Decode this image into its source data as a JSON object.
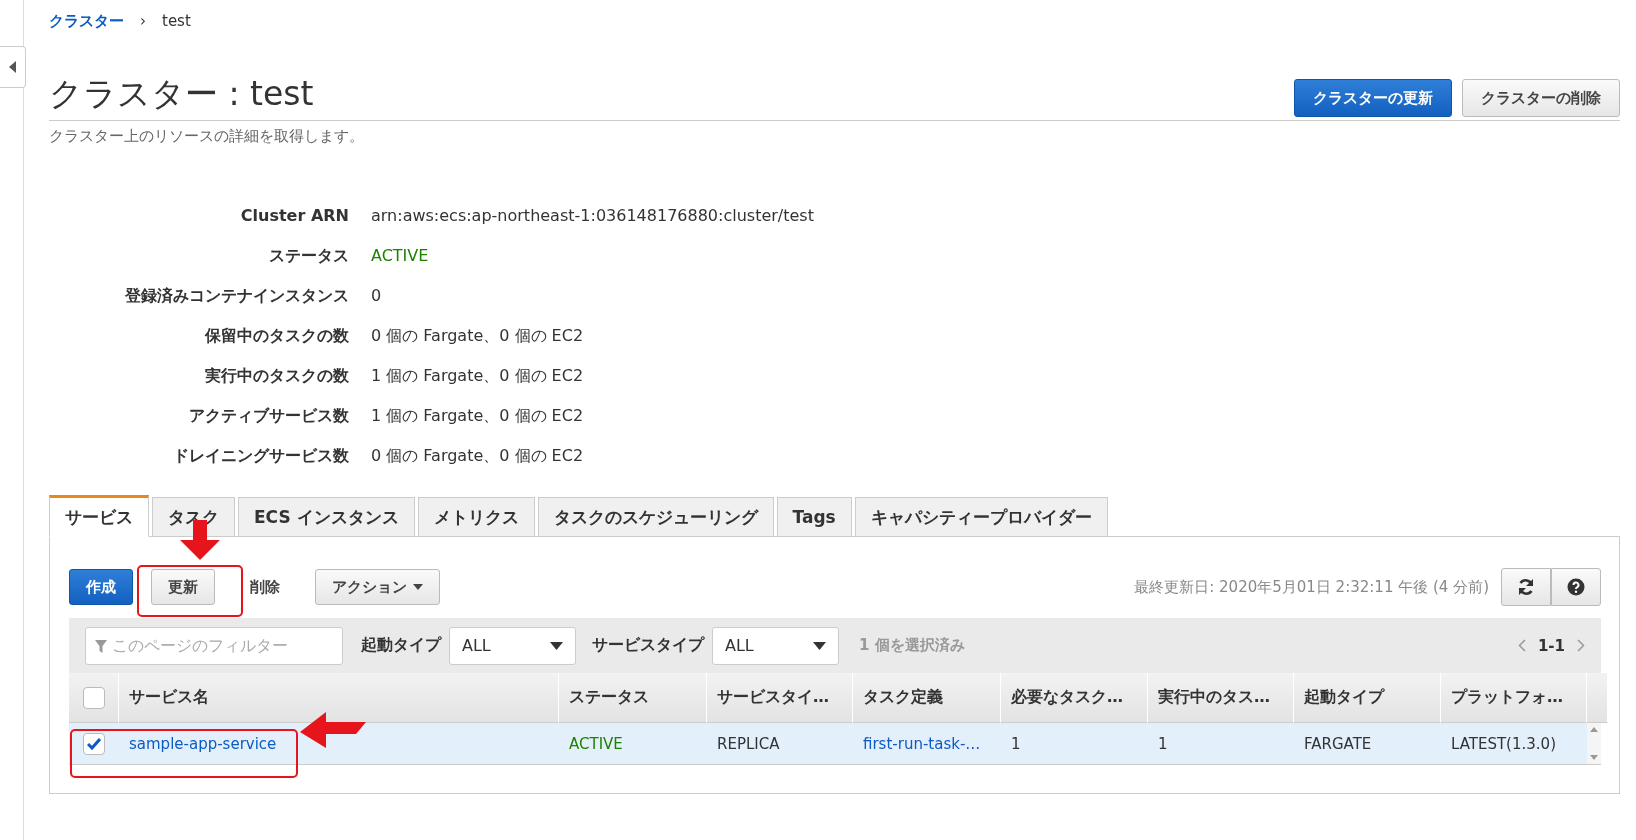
{
  "breadcrumb": {
    "link": "クラスター",
    "separator": "›",
    "current": "test"
  },
  "header": {
    "title": "クラスター : test",
    "subtitle": "クラスター上のリソースの詳細を取得します。",
    "buttons": [
      {
        "label": "クラスターの更新",
        "kind": "primary"
      },
      {
        "label": "クラスターの削除",
        "kind": "default"
      }
    ]
  },
  "details": [
    {
      "label": "Cluster ARN",
      "value": "arn:aws:ecs:ap-northeast-1:036148176880:cluster/test",
      "kind": "text"
    },
    {
      "label": "ステータス",
      "value": "ACTIVE",
      "kind": "status"
    },
    {
      "label": "登録済みコンテナインスタンス",
      "value": "0",
      "kind": "text"
    },
    {
      "label": "保留中のタスクの数",
      "value": "0 個の Fargate、0 個の EC2",
      "kind": "text"
    },
    {
      "label": "実行中のタスクの数",
      "value": "1 個の Fargate、0 個の EC2",
      "kind": "text"
    },
    {
      "label": "アクティブサービス数",
      "value": "1 個の Fargate、0 個の EC2",
      "kind": "text"
    },
    {
      "label": "ドレイニングサービス数",
      "value": "0 個の Fargate、0 個の EC2",
      "kind": "text"
    }
  ],
  "tabs": [
    {
      "label": "サービス",
      "selected": true
    },
    {
      "label": "タスク",
      "selected": false
    },
    {
      "label": "ECS インスタンス",
      "selected": false
    },
    {
      "label": "メトリクス",
      "selected": false
    },
    {
      "label": "タスクのスケジューリング",
      "selected": false
    },
    {
      "label": "Tags",
      "selected": false
    },
    {
      "label": "キャパシティープロバイダー",
      "selected": false
    }
  ],
  "toolbar": {
    "buttons": [
      {
        "label": "作成",
        "kind": "primary"
      },
      {
        "label": "更新",
        "kind": "default"
      },
      {
        "label": "削除",
        "kind": "plain"
      },
      {
        "label": "アクション",
        "kind": "dropdown"
      }
    ],
    "last_updated": "最終更新日: 2020年5月01日 2:32:11 午後 (4 分前)"
  },
  "filters": {
    "search": {
      "placeholder": "このページのフィルター"
    },
    "dropdowns": [
      {
        "label": "起動タイプ",
        "value": "ALL"
      },
      {
        "label": "サービスタイプ",
        "value": "ALL"
      }
    ],
    "selection": "1 個を選択済み",
    "pagination": "1-1"
  },
  "table": {
    "header_checked": false,
    "columns": [
      {
        "label": "サービス名",
        "kind": "link"
      },
      {
        "label": "ステータス",
        "kind": "status"
      },
      {
        "label": "サービスタイ…",
        "kind": "text"
      },
      {
        "label": "タスク定義",
        "kind": "link"
      },
      {
        "label": "必要なタスク…",
        "kind": "text"
      },
      {
        "label": "実行中のタス…",
        "kind": "text"
      },
      {
        "label": "起動タイプ",
        "kind": "text"
      },
      {
        "label": "プラットフォ…",
        "kind": "text"
      }
    ],
    "rows": [
      {
        "selected": true,
        "cells": [
          "sample-app-service",
          "ACTIVE",
          "REPLICA",
          "first-run-task-…",
          "1",
          "1",
          "FARGATE",
          "LATEST(1.3.0)"
        ]
      }
    ]
  }
}
